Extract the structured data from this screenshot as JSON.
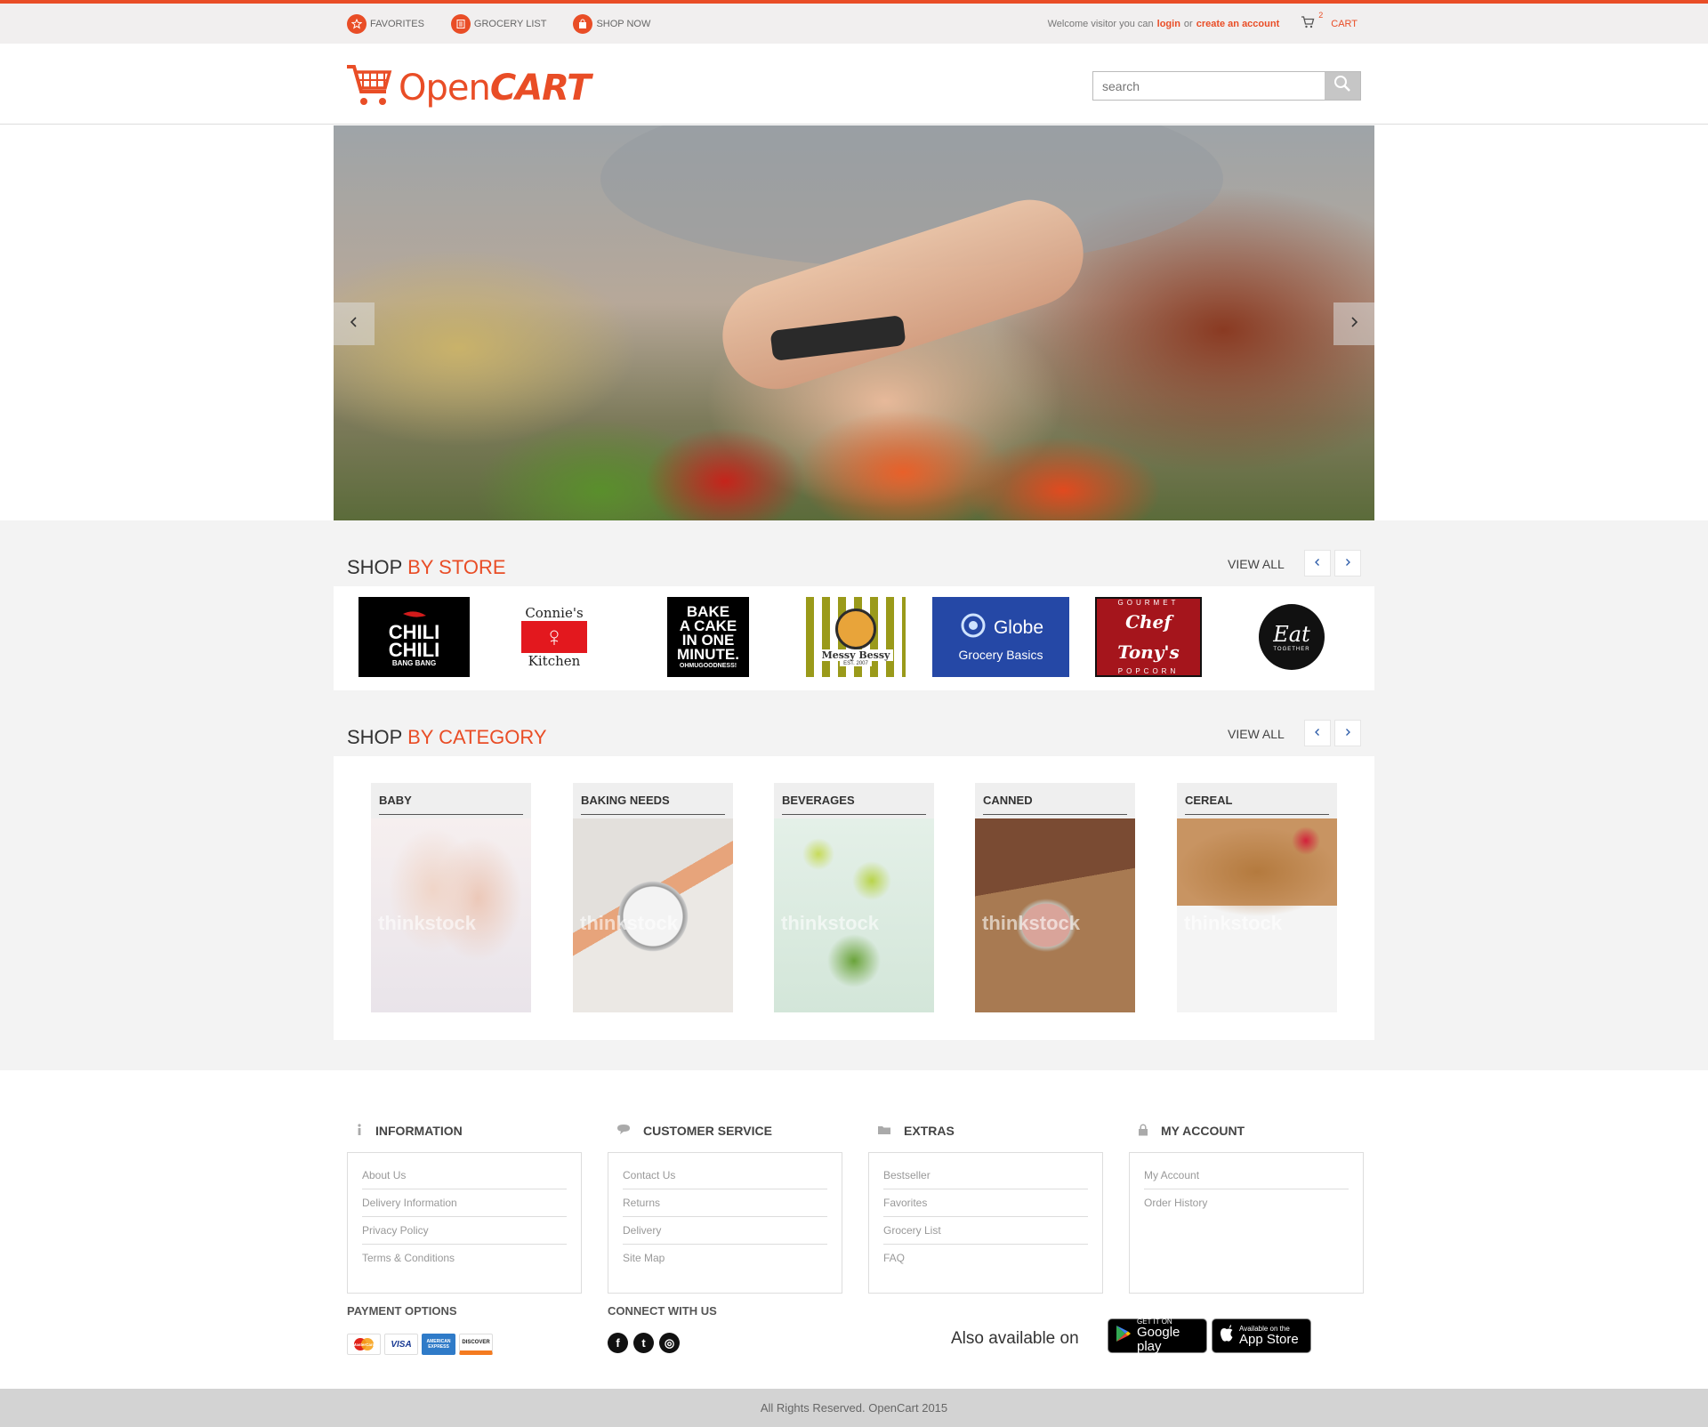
{
  "topbar": {
    "nav": [
      {
        "label": "FAVORITES",
        "icon": "star-icon"
      },
      {
        "label": "GROCERY LIST",
        "icon": "list-icon"
      },
      {
        "label": "SHOP NOW",
        "icon": "bag-icon"
      }
    ],
    "welcome": "Welcome visitor you can",
    "login": "login",
    "or": "or",
    "create_account": "create an account",
    "cart_count": "2",
    "cart_label": "CART"
  },
  "header": {
    "logo_open": "Open",
    "logo_cart": "CART",
    "search_placeholder": "search"
  },
  "shop_by_store": {
    "title_prefix": "SHOP",
    "title_accent": "BY STORE",
    "view_all": "VIEW ALL",
    "stores": [
      {
        "line1": "CHILI",
        "line2": "CHILI",
        "line3": "BANG BANG"
      },
      {
        "line1": "Connie's",
        "line2": "Kitchen"
      },
      {
        "line1": "BAKE",
        "line2": "A CAKE",
        "line3": "IN ONE",
        "line4": "MINUTE.",
        "line5": "OHMUGOODNESS!"
      },
      {
        "line1": "Messy Bessy",
        "line2": "EST. 2007"
      },
      {
        "line1": "Globe",
        "line2": "Grocery Basics"
      },
      {
        "line1": "GOURMET",
        "line2": "Chef Tony's",
        "line3": "POPCORN"
      },
      {
        "line1": "Eat",
        "line2": "TOGETHER"
      }
    ]
  },
  "shop_by_category": {
    "title_prefix": "SHOP",
    "title_accent": "BY CATEGORY",
    "view_all": "VIEW ALL",
    "categories": [
      {
        "label": "BABY"
      },
      {
        "label": "BAKING NEEDS"
      },
      {
        "label": "BEVERAGES"
      },
      {
        "label": "CANNED"
      },
      {
        "label": "CEREAL"
      }
    ],
    "watermark": "thinkstock"
  },
  "footer": {
    "columns": [
      {
        "title": "INFORMATION",
        "icon": "info-icon",
        "links": [
          "About Us",
          "Delivery Information",
          "Privacy Policy",
          "Terms & Conditions"
        ]
      },
      {
        "title": "CUSTOMER SERVICE",
        "icon": "chat-icon",
        "links": [
          "Contact Us",
          "Returns",
          "Delivery",
          "Site Map"
        ]
      },
      {
        "title": "EXTRAS",
        "icon": "folder-icon",
        "links": [
          "Bestseller",
          "Favorites",
          "Grocery List",
          "FAQ"
        ]
      },
      {
        "title": "MY ACCOUNT",
        "icon": "lock-icon",
        "links": [
          "My Account",
          "Order History"
        ]
      }
    ],
    "payment_title": "PAYMENT OPTIONS",
    "payment_cards": [
      "MasterCard",
      "VISA",
      "AMERICAN EXPRESS",
      "DISCOVER"
    ],
    "connect_title": "CONNECT WITH US",
    "social": [
      {
        "icon": "facebook-icon",
        "glyph": "f"
      },
      {
        "icon": "twitter-icon",
        "glyph": "t"
      },
      {
        "icon": "instagram-icon",
        "glyph": "◎"
      }
    ],
    "also_available": "Also available on",
    "google_play_small": "GET IT ON",
    "google_play": "Google play",
    "app_store_small": "Available on the",
    "app_store": "App Store",
    "copyright": "All Rights Reserved. OpenCart 2015"
  },
  "colors": {
    "accent": "#e94d26",
    "topbar_bg": "#f1efef",
    "band_bg": "#f3f3f3",
    "footer_bar": "#d3d3d3"
  }
}
